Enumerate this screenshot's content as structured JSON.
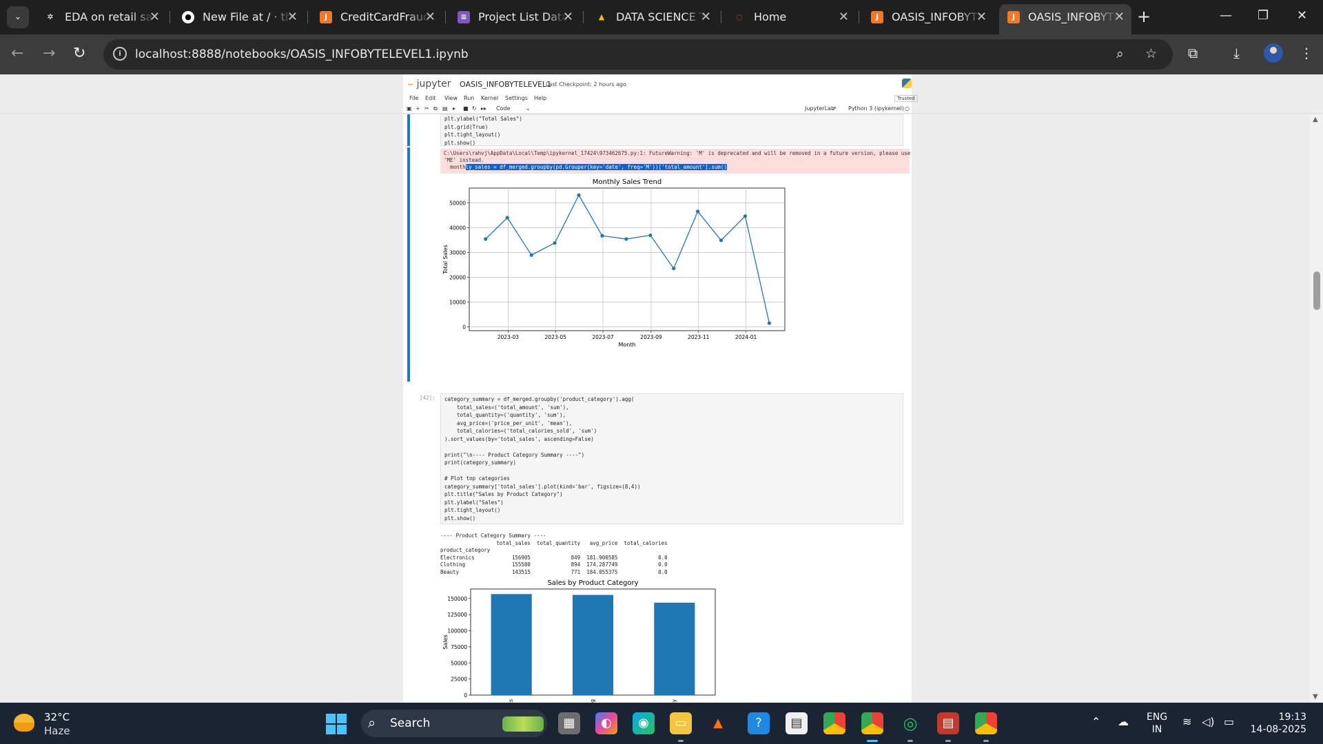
{
  "browser": {
    "tabs": [
      {
        "title": "EDA on retail sal",
        "icon": "openai-icon"
      },
      {
        "title": "New File at / · th",
        "icon": "github-icon"
      },
      {
        "title": "CreditCardFraud",
        "icon": "jupyter-book-icon"
      },
      {
        "title": "Project List Data",
        "icon": "form-icon"
      },
      {
        "title": "DATA SCIENCE T/",
        "icon": "drive-icon"
      },
      {
        "title": "Home",
        "icon": "jupyter-icon"
      },
      {
        "title": "OASIS_INFOBYTE",
        "icon": "jupyter-book-icon"
      },
      {
        "title": "OASIS_INFOBYTE",
        "icon": "jupyter-book-icon"
      }
    ],
    "url": "localhost:8888/notebooks/OASIS_INFOBYTELEVEL1.ipynb"
  },
  "jupyter": {
    "logo": "jupyter",
    "notebook_name": "OASIS_INFOBYTELEVEL1",
    "checkpoint": "Last Checkpoint: 2 hours ago",
    "menu": [
      "File",
      "Edit",
      "View",
      "Run",
      "Kernel",
      "Settings",
      "Help"
    ],
    "trusted": "Trusted",
    "cell_type": "Code",
    "jupyterlab_link": "JupyterLab",
    "kernel": "Python 3 (ipykernel)"
  },
  "cells": {
    "cell1_code": "plt.ylabel(\"Total Sales\")\nplt.grid(True)\nplt.tight_layout()\nplt.show()",
    "warning_line1": "C:\\Users\\rahvj\\AppData\\Local\\Temp\\ipykernel_17424\\973462675.py:1: FutureWarning: 'M' is deprecated and will be removed in a future version, please use",
    "warning_line2": "'ME' instead.",
    "warning_line3_prefix": "  month",
    "warning_line3_highlight": "ly_sales = df_merged.groupby(pd.Grouper(key='date', freq='M'))['total_amount'].sum()",
    "cell2_prompt": "[42]:",
    "cell2_code": "category_summary = df_merged.groupby('product_category').agg(\n    total_sales=('total_amount', 'sum'),\n    total_quantity=('quantity', 'sum'),\n    avg_price=('price_per_unit', 'mean'),\n    total_calories=('total_calories_sold', 'sum')\n).sort_values(by='total_sales', ascending=False)\n\nprint(\"\\n---- Product Category Summary ----\")\nprint(category_summary)\n\n# Plot top categories\ncategory_summary['total_sales'].plot(kind='bar', figsize=(8,4))\nplt.title(\"Sales by Product Category\")\nplt.ylabel(\"Sales\")\nplt.tight_layout()\nplt.show()",
    "cell2_output": "---- Product Category Summary ----\n                  total_sales  total_quantity   avg_price  total_calories\nproduct_category\nElectronics            156905             849  181.900585             0.0\nClothing               155580             894  174.287749             0.0\nBeauty                 143515             771  184.055375             0.0"
  },
  "chart_data": [
    {
      "type": "line",
      "title": "Monthly Sales Trend",
      "xlabel": "Month",
      "ylabel": "Total Sales",
      "x": [
        "2023-01-31",
        "2023-02-28",
        "2023-03-31",
        "2023-04-30",
        "2023-05-31",
        "2023-06-30",
        "2023-07-31",
        "2023-08-31",
        "2023-09-30",
        "2023-10-31",
        "2023-11-30",
        "2023-12-31",
        "2024-01-31"
      ],
      "values": [
        35450,
        44060,
        28990,
        33870,
        53150,
        36760,
        35470,
        36960,
        23580,
        46580,
        34920,
        44690,
        1530
      ],
      "xticks": [
        "2023-03",
        "2023-05",
        "2023-07",
        "2023-09",
        "2023-11",
        "2024-01"
      ],
      "yticks": [
        0,
        10000,
        20000,
        30000,
        40000,
        50000
      ],
      "ylim": [
        -1500,
        56000
      ],
      "grid": true,
      "color": "#1f77b4"
    },
    {
      "type": "bar",
      "title": "Sales by Product Category",
      "ylabel": "Sales",
      "categories": [
        "Electronics",
        "Clothing",
        "Beauty"
      ],
      "values": [
        156905,
        155580,
        143515
      ],
      "yticks": [
        0,
        25000,
        50000,
        75000,
        100000,
        125000,
        150000
      ],
      "ylim": [
        0,
        164750
      ],
      "color": "#1f77b4"
    }
  ],
  "taskbar": {
    "temperature": "32°C",
    "weather": "Haze",
    "search_label": "Search",
    "lang1": "ENG",
    "lang2": "IN",
    "time": "19:13",
    "date": "14-08-2025"
  }
}
